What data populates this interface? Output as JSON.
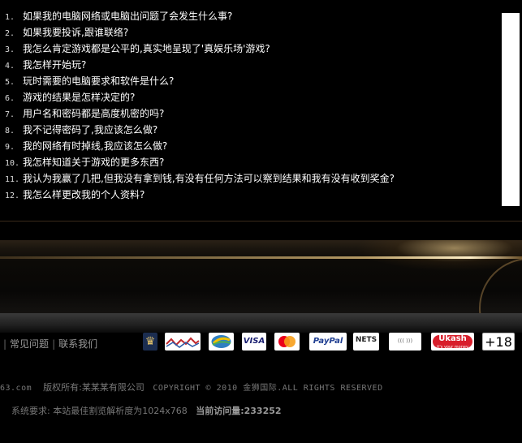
{
  "faq": [
    {
      "num": "1.",
      "text": "如果我的电脑网络或电脑出问题了会发生什么事?"
    },
    {
      "num": "2.",
      "text": "如果我要投诉,跟谁联络?"
    },
    {
      "num": "3.",
      "text": "我怎么肯定游戏都是公平的,真实地呈现了'真娱乐场'游戏?"
    },
    {
      "num": "4.",
      "text": "我怎样开始玩?"
    },
    {
      "num": "5.",
      "text": "玩时需要的电脑要求和软件是什么?"
    },
    {
      "num": "6.",
      "text": "游戏的结果是怎样决定的?"
    },
    {
      "num": "7.",
      "text": "用户名和密码都是高度机密的吗?"
    },
    {
      "num": "8.",
      "text": "我不记得密码了,我应该怎么做?"
    },
    {
      "num": "9.",
      "text": "我的网络有时掉线,我应该怎么做?"
    },
    {
      "num": "10.",
      "text": "我怎样知道关于游戏的更多东西?"
    },
    {
      "num": "11.",
      "text": "我认为我赢了几把,但我没有拿到钱,有没有任何方法可以察到结果和我有没有收到奖金?"
    },
    {
      "num": "12.",
      "text": "我怎么样更改我的个人资料?"
    }
  ],
  "footer": {
    "links_prefix": "|",
    "faq_link": "常见问题",
    "separator": "|",
    "contact_link": "联系我们"
  },
  "badges": {
    "lion": "♛",
    "visa": "VISA",
    "paypal": "PayPal",
    "nets": "NETS",
    "neo": "((( ))) MONEYBOOK",
    "ukash": "Ukash",
    "ukash_tag": "it's your money",
    "age": "+18"
  },
  "copyright": {
    "domain": "63.com",
    "owner": "版权所有:某某某有限公司",
    "notice": "COPYRIGHT © 2010 金狮国际.ALL RIGHTS RESERVED"
  },
  "sysreq": {
    "label": "系统要求: 本站最佳割览解析度为1024x768",
    "visits_label": "当前访问量:",
    "visits_value": "233252"
  },
  "colors": {
    "background": "#000000",
    "text": "#ffffff",
    "muted": "#777777",
    "accent_gold": "#c8a26a"
  }
}
